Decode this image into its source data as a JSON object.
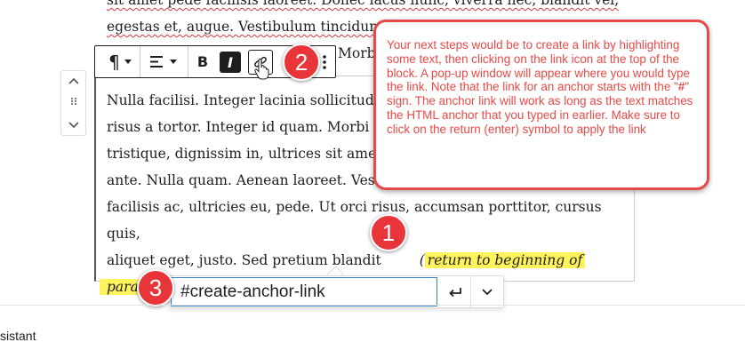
{
  "background_text": {
    "line1": "sit amet pede facilisis laoreet. Donec lacus nunc, viverra nec, blandit vel,",
    "line2": "egestas et, augue. Vestibulum tincidunt",
    "line3_tail": "Morbi"
  },
  "block_toolbar": {
    "paragraph_icon": "pilcrow-icon",
    "align_icon": "align-left-icon",
    "bold_label": "B",
    "italic_label": "I",
    "link_icon": "link-icon",
    "more_icon": "vertical-ellipsis-icon"
  },
  "mover": {
    "up_icon": "chevron-up-icon",
    "drag_icon": "drag-handle-icon",
    "down_icon": "chevron-down-icon"
  },
  "paragraph": {
    "lines": [
      "Nulla facilisi. Integer lacinia sollicitudin",
      "risus a tortor. Integer id quam. Morbi m",
      "tristique, dignissim in, ultrices sit amet,",
      "ante. Nulla quam. Aenean laoreet. Vesti",
      "facilisis ac, ultricies eu, pede. Ut orci risus, accumsan porttitor, cursus quis,",
      "aliquet eget, justo. Sed pretium blandit"
    ],
    "highlight_open": "(",
    "highlight_part1": "return to beginning of",
    "highlight_part2": "paragraph.",
    "highlight_close": ")"
  },
  "link_popover": {
    "input_value": "#create-anchor-link",
    "submit_icon": "return-enter-icon",
    "expand_icon": "chevron-down-icon"
  },
  "annotations": {
    "badge1": "1",
    "badge2": "2",
    "badge3": "3",
    "callout_text_part1": "Your next steps would be to create a link by highlighting some text, then clicking on the link icon at the top of the block.  A pop-up window will appear where you would type the link.  Note that the link for an anchor starts with the \"",
    "callout_hash": "#",
    "callout_text_part2": "\" sign. The anchor link will work as long as the text matches the HTML anchor that you typed in earlier.  Make sure to click on the return (enter) symbol to apply the link",
    "color": "#e64a46"
  },
  "bottom_panel": {
    "label": "sistant"
  },
  "colors": {
    "highlight": "#fff35c",
    "input_border": "#3b82c4",
    "badge": "#e8353a"
  }
}
